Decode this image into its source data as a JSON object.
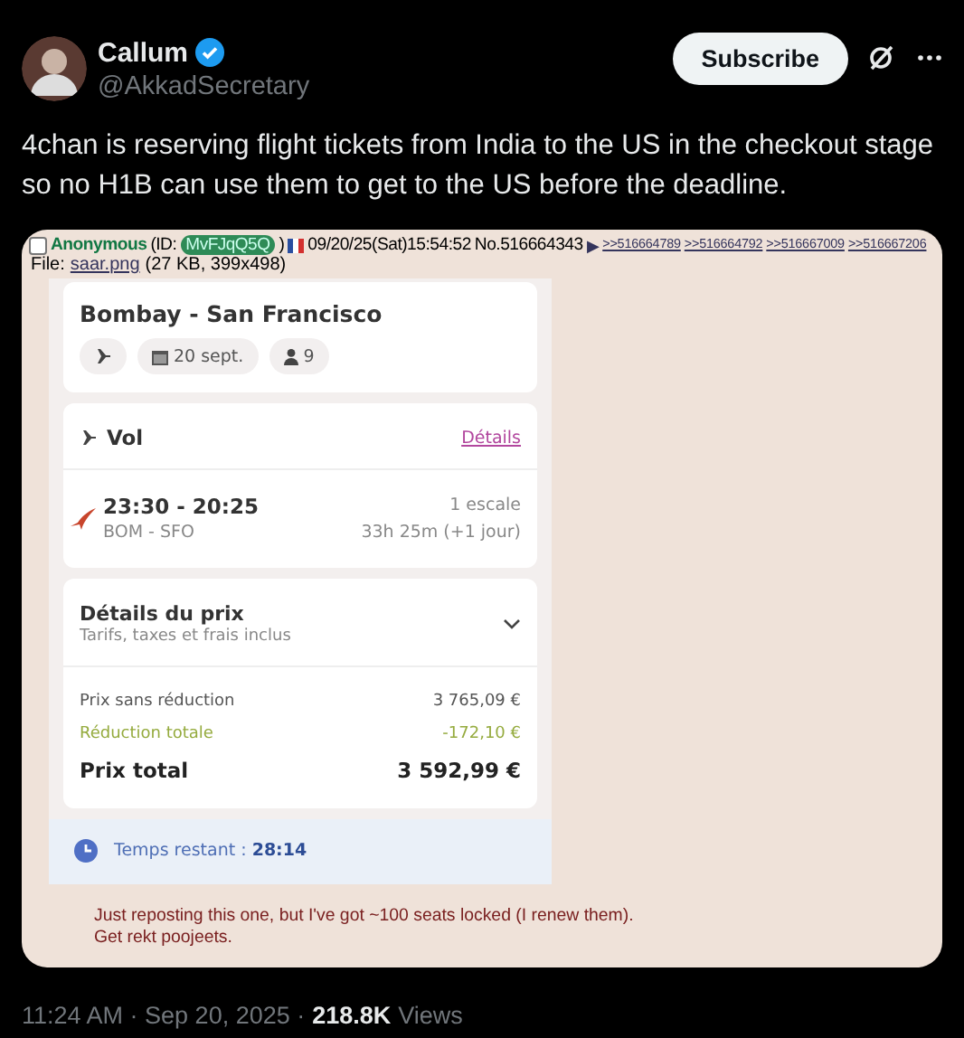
{
  "author": {
    "name": "Callum",
    "verified": true,
    "handle": "@AkkadSecretary"
  },
  "subscribe_button": "Subscribe",
  "tweet_text": "4chan is reserving flight tickets from India to the US in the checkout stage so no H1B can use them to get to the US before the deadline.",
  "post": {
    "checked": false,
    "name": "Anonymous",
    "id_prefix": "(ID:",
    "id": "MvFJqQ5Q",
    "id_suffix": ")",
    "datetime": "09/20/25(Sat)15:54:52",
    "number": "No.516664343",
    "arrow": "▶",
    "replies": [
      ">>516664789",
      ">>516664792",
      ">>516667009",
      ">>516667206"
    ],
    "file_label": "File:",
    "file_name": "saar.png",
    "file_info": "(27 KB, 399x498)",
    "comment": [
      "Just reposting this one, but I've got ~100 seats locked (I renew them).",
      "Get rekt poojeets."
    ]
  },
  "booking": {
    "route": "Bombay - San Francisco",
    "chips": [
      {
        "kind": "plane"
      },
      {
        "kind": "calendar",
        "label": "20 sept."
      },
      {
        "kind": "person",
        "label": "9"
      }
    ],
    "flight": {
      "title": "Vol",
      "link": "Détails",
      "times": "23:30 - 20:25",
      "airports": "BOM - SFO",
      "stops": "1 escale",
      "duration": "33h 25m (+1 jour)"
    },
    "price": {
      "title": "Détails du prix",
      "subtitle": "Tarifs, taxes et frais inclus",
      "expanded": true,
      "rows": [
        {
          "kind": "normal",
          "label": "Prix sans réduction",
          "value": "3 765,09 €"
        },
        {
          "kind": "discount",
          "label": "Réduction totale",
          "value": "-172,10 €"
        },
        {
          "kind": "total",
          "label": "Prix total",
          "value": "3 592,99 €"
        }
      ]
    },
    "timer": {
      "label": "Temps restant :",
      "value": "28:14"
    }
  },
  "footer": {
    "time": "11:24 AM · Sep 20, 2025 ·",
    "views_count": "218.8K",
    "views_label": "Views"
  }
}
